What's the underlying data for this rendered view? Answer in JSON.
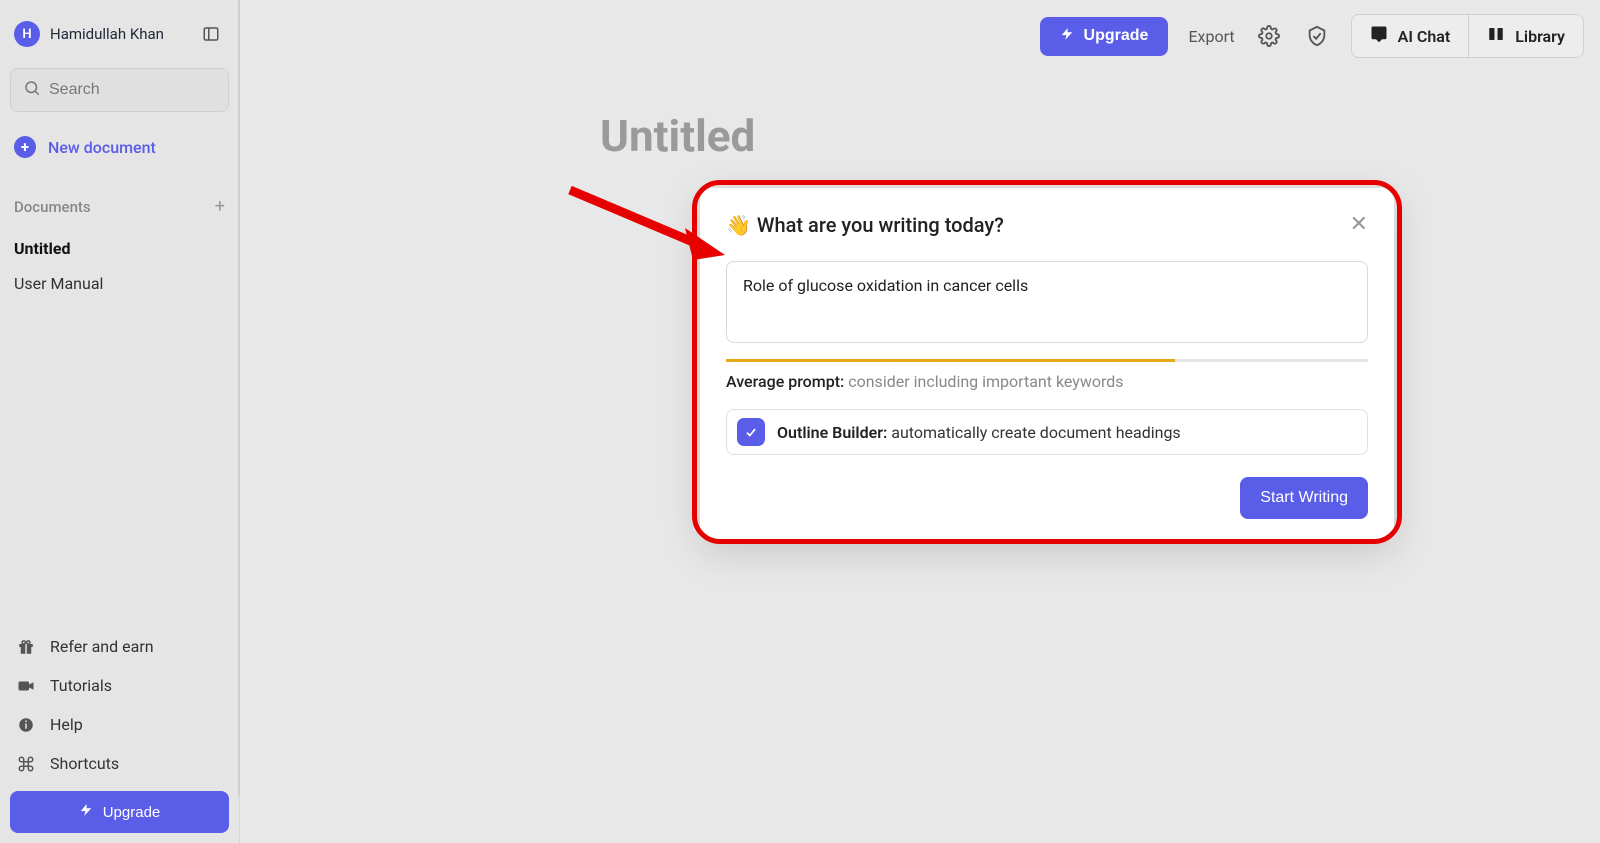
{
  "user": {
    "initial": "H",
    "name": "Hamidullah Khan"
  },
  "search": {
    "placeholder": "Search"
  },
  "sidebar": {
    "new_document": "New document",
    "documents_label": "Documents",
    "docs": [
      {
        "label": "Untitled",
        "active": true
      },
      {
        "label": "User Manual",
        "active": false
      }
    ],
    "footer": {
      "refer": "Refer and earn",
      "tutorials": "Tutorials",
      "help": "Help",
      "shortcuts": "Shortcuts",
      "upgrade": "Upgrade"
    }
  },
  "topbar": {
    "upgrade": "Upgrade",
    "export": "Export",
    "ai_chat": "AI Chat",
    "library": "Library"
  },
  "document": {
    "title": "Untitled"
  },
  "dialog": {
    "title": "What are you writing today?",
    "prompt_text": "Role of glucose oxidation in cancer cells",
    "quality_label": "Average prompt:",
    "quality_hint": "consider including important keywords",
    "outline_label": "Outline Builder:",
    "outline_desc": "automatically create document headings",
    "start_button": "Start Writing",
    "progress_percent": 70
  }
}
